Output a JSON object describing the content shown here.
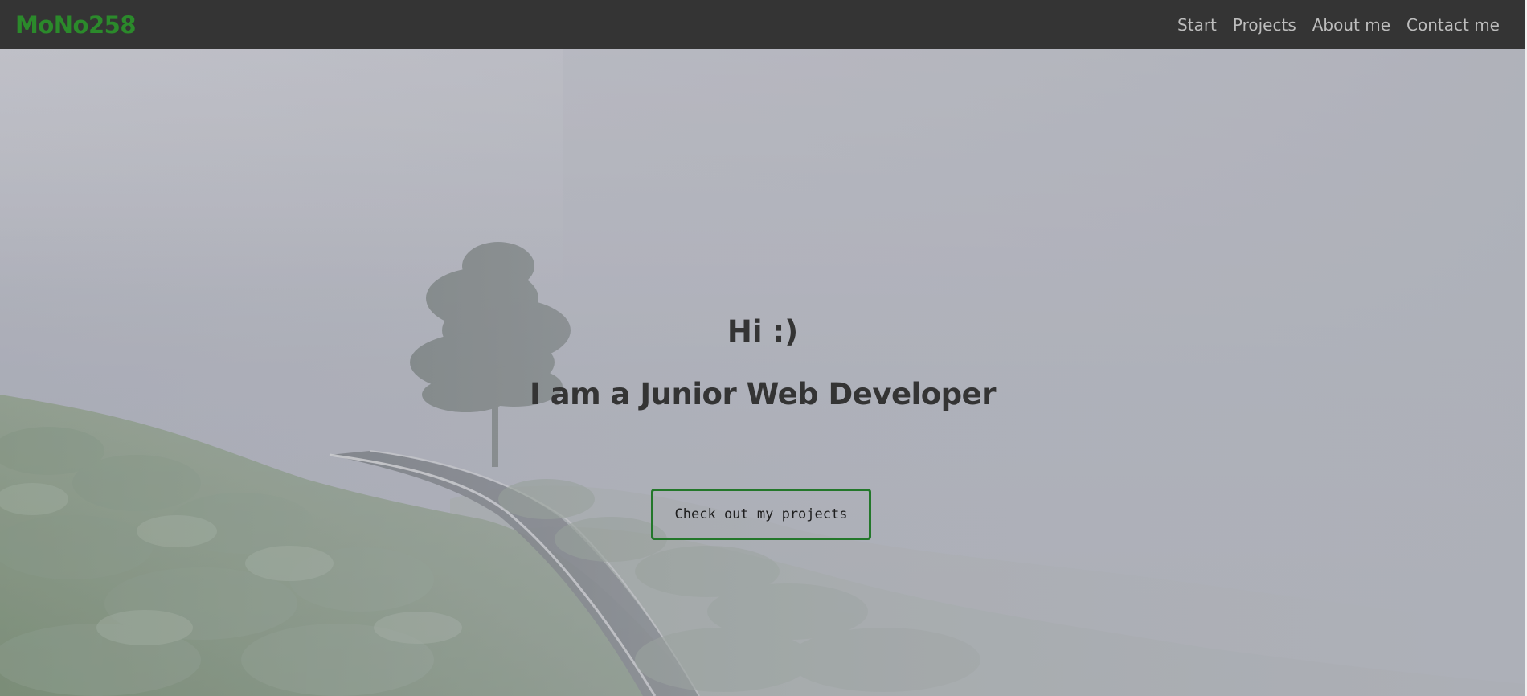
{
  "navbar": {
    "brand": "MoNo258",
    "links": [
      {
        "label": "Start"
      },
      {
        "label": "Projects"
      },
      {
        "label": "About me"
      },
      {
        "label": "Contact me"
      }
    ]
  },
  "hero": {
    "greeting": "Hi :)",
    "title": "I am a Junior Web Developer",
    "cta_label": "Check out my projects",
    "background": "misty-hillside-with-tree-and-road-photo"
  },
  "colors": {
    "navbar_bg": "#343434",
    "brand": "#2b8a2b",
    "nav_link": "#bdbdbd",
    "hero_text": "#343434",
    "cta_border": "#23772a"
  }
}
